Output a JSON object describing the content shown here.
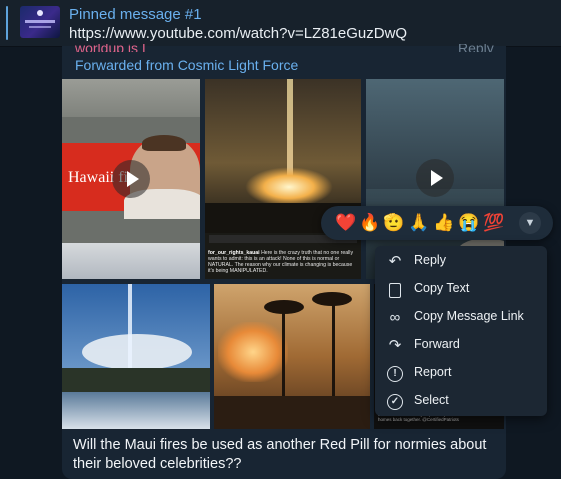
{
  "pinned": {
    "title": "Pinned message #1",
    "text": "https://www.youtube.com/watch?v=LZ81eGuzDwQ"
  },
  "message": {
    "sender_cut": "worldup is I",
    "reply_cut": "Reply",
    "forwarded_from": "Forwarded from Cosmic Light Force",
    "media": {
      "tile1_caption": "Hawaii fi",
      "tile2_caption_user": "for_our_rights_kauai",
      "tile2_caption_text": "Here is the crazy truth that no one really wants to admit: this is an attack! None of this is normal or NATURAL. The reason why our climate is changing is because it's being MANIPULATED.",
      "tile6_note": "thousands of locals try to put the pieces of their lives and homes back together. @CertifiedPatriots"
    },
    "text": "Will the Maui fires be used as another Red Pill for normies about their beloved celebrities??"
  },
  "reactions": {
    "items": [
      "❤️",
      "🔥",
      "🫡",
      "🙏",
      "👍",
      "😭",
      "💯"
    ],
    "expand_icon": "chevron-down-icon"
  },
  "context_menu": {
    "items": [
      {
        "label": "Reply",
        "icon": "reply-icon"
      },
      {
        "label": "Copy Text",
        "icon": "copy-icon"
      },
      {
        "label": "Copy Message Link",
        "icon": "link-icon"
      },
      {
        "label": "Forward",
        "icon": "forward-icon"
      },
      {
        "label": "Report",
        "icon": "report-icon"
      },
      {
        "label": "Select",
        "icon": "select-icon"
      }
    ]
  },
  "colors": {
    "background": "#0f1822",
    "bubble": "#182533",
    "accent_link": "#6ab0ee",
    "menu_background": "#1c2733"
  }
}
